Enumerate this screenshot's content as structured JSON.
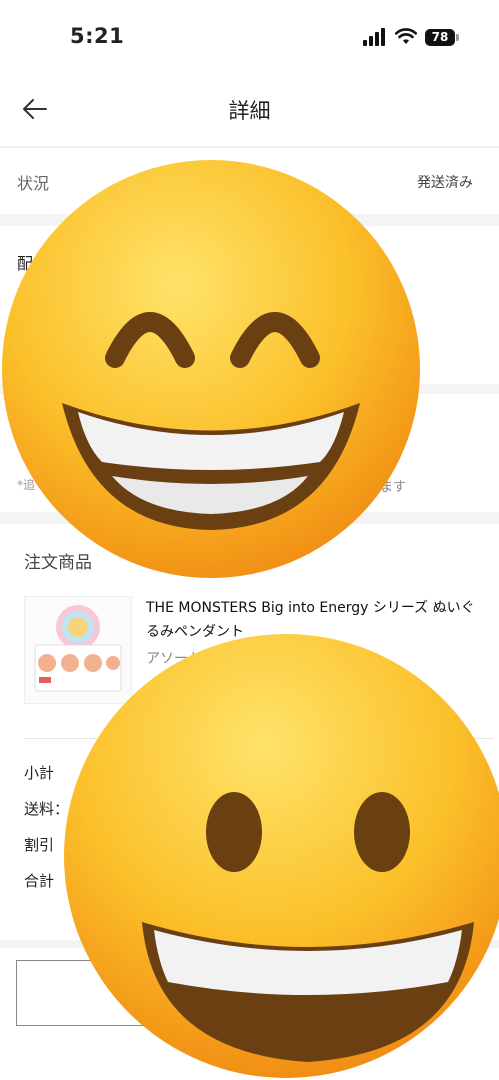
{
  "status_bar": {
    "time": "5:21",
    "battery": "78",
    "icons": [
      "signal-icon",
      "wifi-icon",
      "battery-icon"
    ]
  },
  "nav": {
    "back_icon": "arrow-left-icon",
    "title": "詳細"
  },
  "status_row": {
    "label": "状況",
    "value": "発送済み"
  },
  "address_section": {
    "label_partial": "配"
  },
  "notice": {
    "partial_left": "*追",
    "partial_right": "ます"
  },
  "order_items": {
    "title": "注文商品",
    "product_name": "THE MONSTERS Big into Energy シリーズ ぬいぐるみペンダント",
    "variant_partial": "アソート"
  },
  "summary": {
    "subtotal_label": "小計",
    "shipping_label": "送料：",
    "discount_label": "割引",
    "total_label": "合計"
  },
  "overlay": {
    "emoji_top": "grinning-squinting-face-emoji",
    "emoji_bottom": "grinning-face-emoji"
  }
}
